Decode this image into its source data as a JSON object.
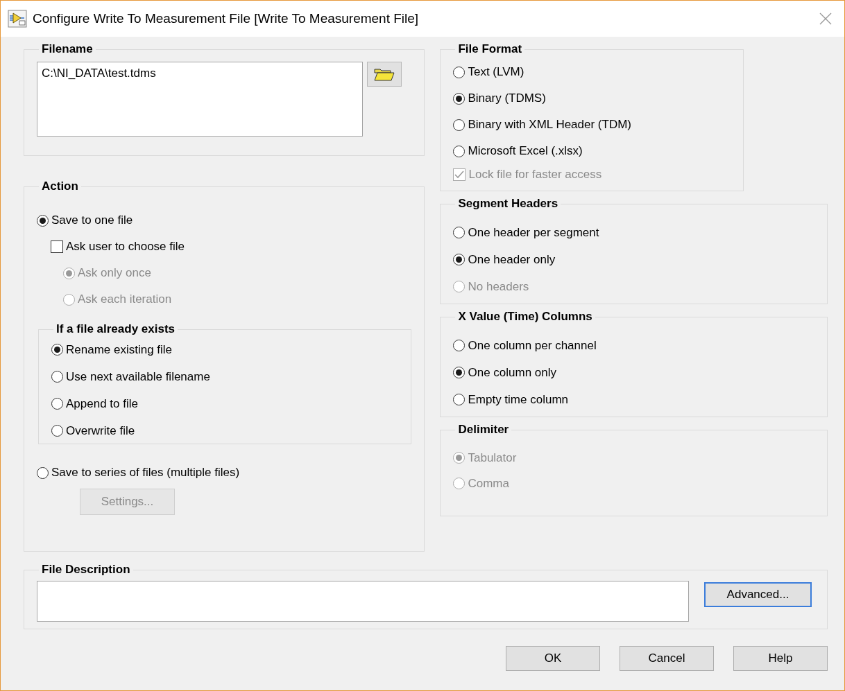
{
  "window": {
    "title": "Configure Write To Measurement File [Write To Measurement File]"
  },
  "filename": {
    "title": "Filename",
    "value": "C:\\NI_DATA\\test.tdms"
  },
  "action": {
    "title": "Action",
    "save_one": {
      "label": "Save to one file",
      "selected": true
    },
    "ask_user": {
      "label": "Ask user to choose file",
      "checked": false
    },
    "ask_options": [
      {
        "label": "Ask only once",
        "selected": true,
        "disabled": true
      },
      {
        "label": "Ask each iteration",
        "selected": false,
        "disabled": true
      }
    ],
    "exists": {
      "title": "If a file already exists",
      "options": [
        {
          "label": "Rename existing file",
          "selected": true
        },
        {
          "label": "Use next available filename",
          "selected": false
        },
        {
          "label": "Append to file",
          "selected": false
        },
        {
          "label": "Overwrite file",
          "selected": false
        }
      ]
    },
    "save_series": {
      "label": "Save to series of files (multiple files)",
      "selected": false
    },
    "settings_button": {
      "label": "Settings...",
      "disabled": true
    }
  },
  "file_format": {
    "title": "File Format",
    "options": [
      {
        "label": "Text (LVM)",
        "selected": false
      },
      {
        "label": "Binary (TDMS)",
        "selected": true
      },
      {
        "label": "Binary with XML Header (TDM)",
        "selected": false
      },
      {
        "label": "Microsoft Excel (.xlsx)",
        "selected": false
      }
    ],
    "lock": {
      "label": "Lock file for faster access",
      "checked": true,
      "disabled": true
    }
  },
  "segment_headers": {
    "title": "Segment Headers",
    "options": [
      {
        "label": "One header per segment",
        "selected": false,
        "disabled": false
      },
      {
        "label": "One header only",
        "selected": true,
        "disabled": false
      },
      {
        "label": "No headers",
        "selected": false,
        "disabled": true
      }
    ]
  },
  "x_columns": {
    "title": "X Value (Time) Columns",
    "options": [
      {
        "label": "One column per channel",
        "selected": false
      },
      {
        "label": "One column only",
        "selected": true
      },
      {
        "label": "Empty time column",
        "selected": false
      }
    ]
  },
  "delimiter": {
    "title": "Delimiter",
    "options": [
      {
        "label": "Tabulator",
        "selected": true,
        "disabled": true
      },
      {
        "label": "Comma",
        "selected": false,
        "disabled": true
      }
    ]
  },
  "file_description": {
    "title": "File Description",
    "advanced_button": {
      "label": "Advanced...",
      "focused": true
    }
  },
  "buttons": [
    {
      "label": "OK"
    },
    {
      "label": "Cancel"
    },
    {
      "label": "Help"
    }
  ]
}
